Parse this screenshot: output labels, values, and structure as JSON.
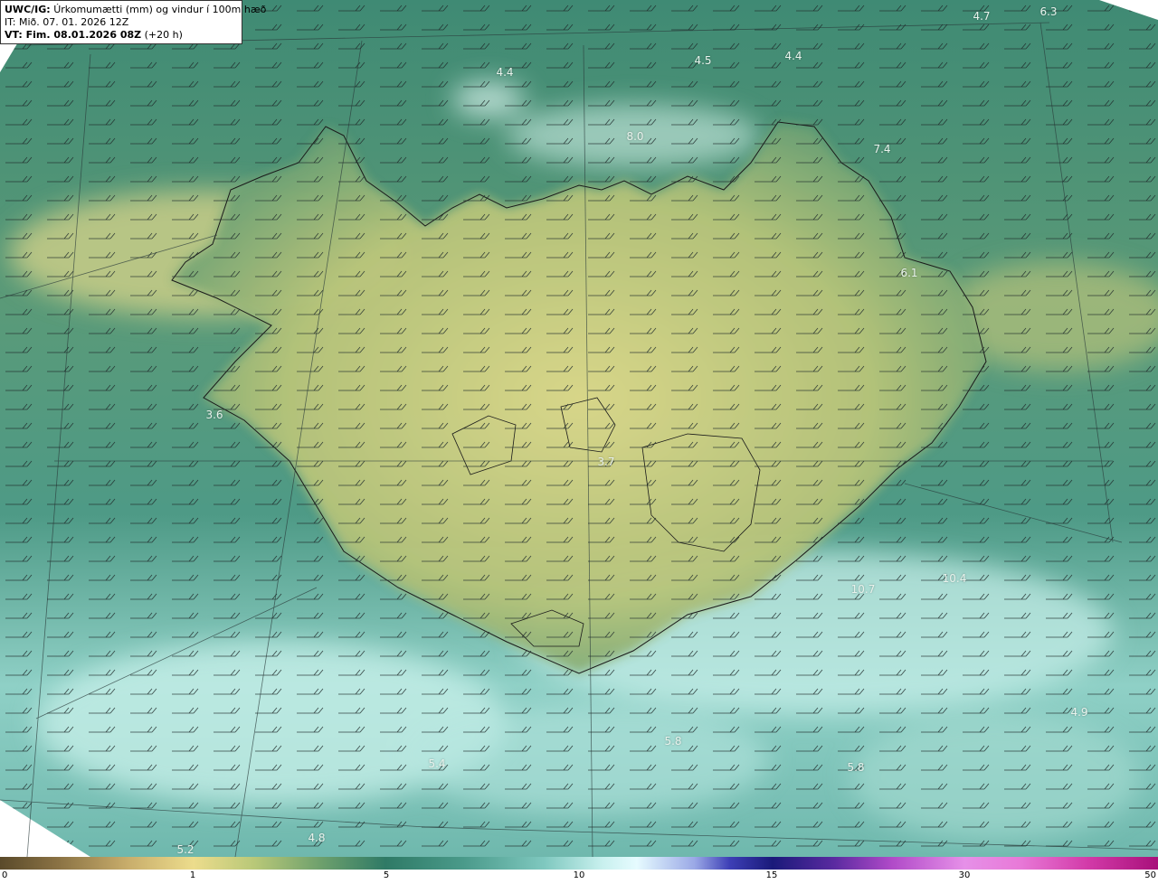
{
  "header": {
    "product_label": "UWC/IG:",
    "title": "Úrkomumætti (mm) og vindur í 100m hæð",
    "issue_time": "IT: Mið. 07. 01. 2026 12Z",
    "valid_time_label": "VT: Fim. 08.01.2026 08Z",
    "lead_time": "(+20 h)"
  },
  "map": {
    "region": "Iceland",
    "value_labels": [
      "4.7",
      "6.3",
      "4.4",
      "4.5",
      "4.4",
      "8.0",
      "7.4",
      "6.1",
      "3.6",
      "3.7",
      "10.7",
      "10.4",
      "4.9",
      "5.8",
      "5.8",
      "5.4",
      "4.8",
      "5.2"
    ]
  },
  "colorbar": {
    "tick_labels": [
      "0",
      "1",
      "5",
      "10",
      "15",
      "30",
      "50"
    ],
    "colors": {
      "dry": "#5a4a2a",
      "low": "#ecdc8c",
      "mid": "#2f7a66",
      "high": "#e6fbff",
      "very_high": "#1a1a7a",
      "extreme": "#a8107a"
    }
  }
}
